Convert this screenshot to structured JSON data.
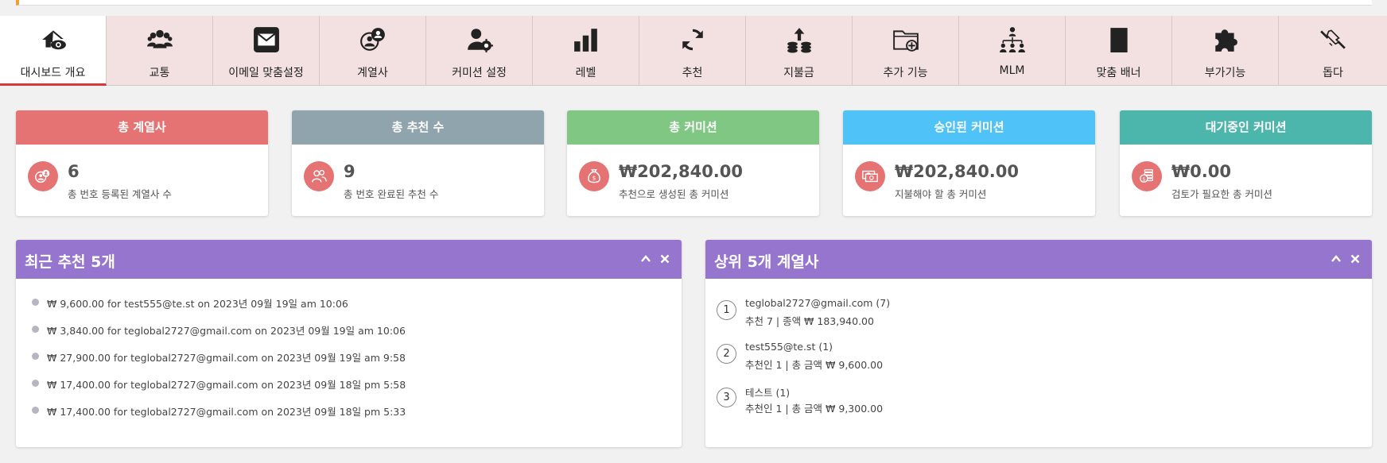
{
  "tabs": [
    {
      "label": "대시보드 개요",
      "icon": "dashboard-eye-icon",
      "active": true
    },
    {
      "label": "교통",
      "icon": "users-group-icon"
    },
    {
      "label": "이메일 맞춤설정",
      "icon": "envelope-icon"
    },
    {
      "label": "계열사",
      "icon": "affiliate-icon"
    },
    {
      "label": "커미션 설정",
      "icon": "user-gear-icon"
    },
    {
      "label": "레벨",
      "icon": "bar-chart-icon"
    },
    {
      "label": "추천",
      "icon": "sync-icon"
    },
    {
      "label": "지불금",
      "icon": "coins-upload-icon"
    },
    {
      "label": "추가 기능",
      "icon": "folder-plus-icon"
    },
    {
      "label": "MLM",
      "icon": "hierarchy-icon"
    },
    {
      "label": "맞춤 배너",
      "icon": "banner-icon"
    },
    {
      "label": "부가기능",
      "icon": "puzzle-icon"
    },
    {
      "label": "돕다",
      "icon": "handshake-icon"
    }
  ],
  "cards": [
    {
      "title": "총 계열사",
      "value": "6",
      "desc": "총 번호 등록된 계열사 수",
      "color": "#e57373",
      "icon": "affiliate-icon"
    },
    {
      "title": "총 추천 수",
      "value": "9",
      "desc": "총 번호 완료된 추천 수",
      "color": "#90a4ae",
      "icon": "users-icon"
    },
    {
      "title": "총 커미션",
      "value": "₩202,840.00",
      "desc": "추천으로 생성된 총 커미션",
      "color": "#81c784",
      "icon": "money-bag-icon"
    },
    {
      "title": "승인된 커미션",
      "value": "₩202,840.00",
      "desc": "지불해야 할 총 커미션",
      "color": "#4fc3f7",
      "icon": "money-stack-icon"
    },
    {
      "title": "대기중인 커미션",
      "value": "₩0.00",
      "desc": "검토가 필요한 총 커미션",
      "color": "#4db6ac",
      "icon": "coins-icon"
    }
  ],
  "recent": {
    "title": "최근 추천 5개",
    "items": [
      "₩ 9,600.00 for test555@te.st on 2023년 09월 19일 am 10:06",
      "₩ 3,840.00 for teglobal2727@gmail.com on 2023년 09월 19일 am 10:06",
      "₩ 27,900.00 for teglobal2727@gmail.com on 2023년 09월 19일 am 9:58",
      "₩ 17,400.00 for teglobal2727@gmail.com on 2023년 09월 18일 pm 5:58",
      "₩ 17,400.00 for teglobal2727@gmail.com on 2023년 09월 18일 pm 5:33"
    ]
  },
  "top": {
    "title": "상위 5개 계열사",
    "items": [
      {
        "rank": "1",
        "line1": "teglobal2727@gmail.com (7)",
        "line2": "추천 7 | 종액 ₩ 183,940.00"
      },
      {
        "rank": "2",
        "line1": "test555@te.st (1)",
        "line2": "추천인 1 | 총 금액 ₩ 9,600.00"
      },
      {
        "rank": "3",
        "line1": "테스트 (1)",
        "line2": "추천인 1 | 총 금액 ₩ 9,300.00"
      }
    ]
  }
}
